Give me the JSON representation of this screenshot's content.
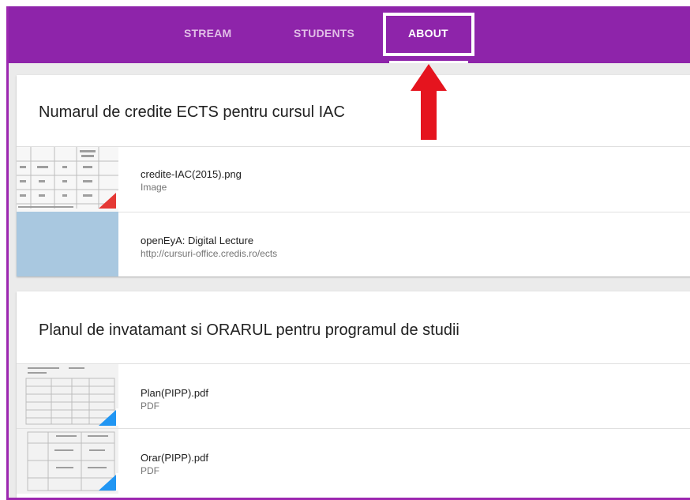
{
  "tabs": [
    {
      "label": "STREAM"
    },
    {
      "label": "STUDENTS"
    },
    {
      "label": "ABOUT"
    }
  ],
  "sections": [
    {
      "title": "Numarul de credite ECTS pentru cursul IAC",
      "items": [
        {
          "name": "credite-IAC(2015).png",
          "subtitle": "Image"
        },
        {
          "name": "openEyA: Digital Lecture",
          "subtitle": "http://cursuri-office.credis.ro/ects"
        }
      ]
    },
    {
      "title": "Planul de invatamant si ORARUL pentru programul de studii",
      "items": [
        {
          "name": "Plan(PIPP).pdf",
          "subtitle": "PDF"
        },
        {
          "name": "Orar(PIPP).pdf",
          "subtitle": "PDF"
        }
      ]
    }
  ],
  "colors": {
    "topbar": "#8e24aa",
    "tab_inactive": "#e1bee7",
    "tab_active": "#ffffff",
    "annotation_arrow": "#e5141e",
    "link_thumbnail": "#a9c8e0",
    "image_badge": "#e53935",
    "pdf_badge": "#2196f3"
  }
}
